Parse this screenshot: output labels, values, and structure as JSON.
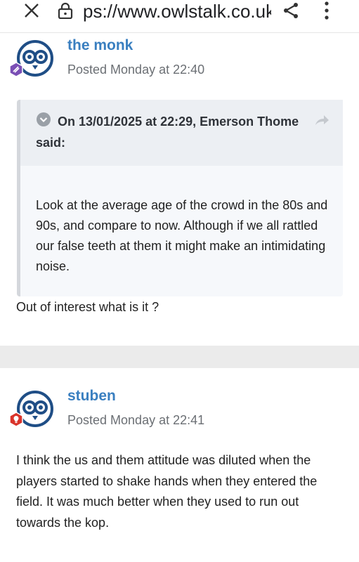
{
  "browser": {
    "url": "ps://www.owlstalk.co.uk/t",
    "icons": [
      "close-icon",
      "lock-icon",
      "share-icon",
      "more-vert-icon"
    ]
  },
  "posts": [
    {
      "author": "the monk",
      "posted": "Posted Monday at 22:40",
      "quote": {
        "attribution": "On 13/01/2025 at 22:29, Emerson Thome said:",
        "body": "Look at the average age of the crowd in the 80s and 90s, and compare to now. Although if we all rattled our false teeth at them it might make an intimidating noise."
      },
      "body": "Out of interest what is it ?"
    },
    {
      "author": "stuben",
      "posted": "Posted Monday at 22:41",
      "body": "I think the us and them attitude was diluted when the players started to shake hands when they entered the field. It was much better when they used to run out towards the kop."
    }
  ],
  "colors": {
    "author": "#3a7fc0",
    "avatar": "#1f4e86",
    "badge_purple": "#7a4fb5",
    "badge_red": "#d9342b",
    "quote_bg": "#f6f8fb",
    "quote_head_bg": "#eceff3"
  }
}
